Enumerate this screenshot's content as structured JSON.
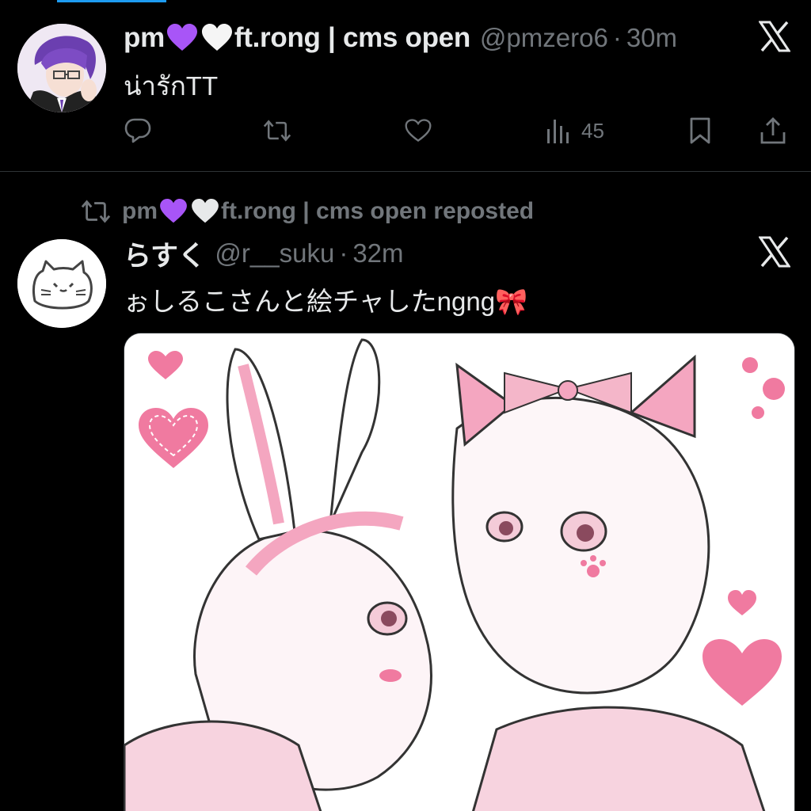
{
  "tweet1": {
    "author_name_part1": "pm",
    "author_name_part2": "ft.rong | cms open",
    "handle": "@pmzero6",
    "separator": "·",
    "time": "30m",
    "text": "น่ารักTT",
    "views": "45"
  },
  "retweet": {
    "name_part1": "pm",
    "name_part2": "ft.rong | cms open reposted"
  },
  "tweet2": {
    "author_name": "らすく",
    "handle": "@r__suku",
    "separator": "·",
    "time": "32m",
    "text": "ぉしるこさんと絵チャしたngng🎀"
  },
  "colors": {
    "background": "#000000",
    "text": "#e7e9ea",
    "muted": "#71767b",
    "accent": "#1d9bf0",
    "purple_heart": "#a855f7",
    "white_heart": "#ffffff",
    "pink": "#f4a6c0"
  },
  "icons": [
    "x-logo-icon",
    "reply-icon",
    "repost-icon",
    "like-icon",
    "views-icon",
    "bookmark-icon",
    "share-icon",
    "purple-heart-icon",
    "white-heart-icon"
  ]
}
